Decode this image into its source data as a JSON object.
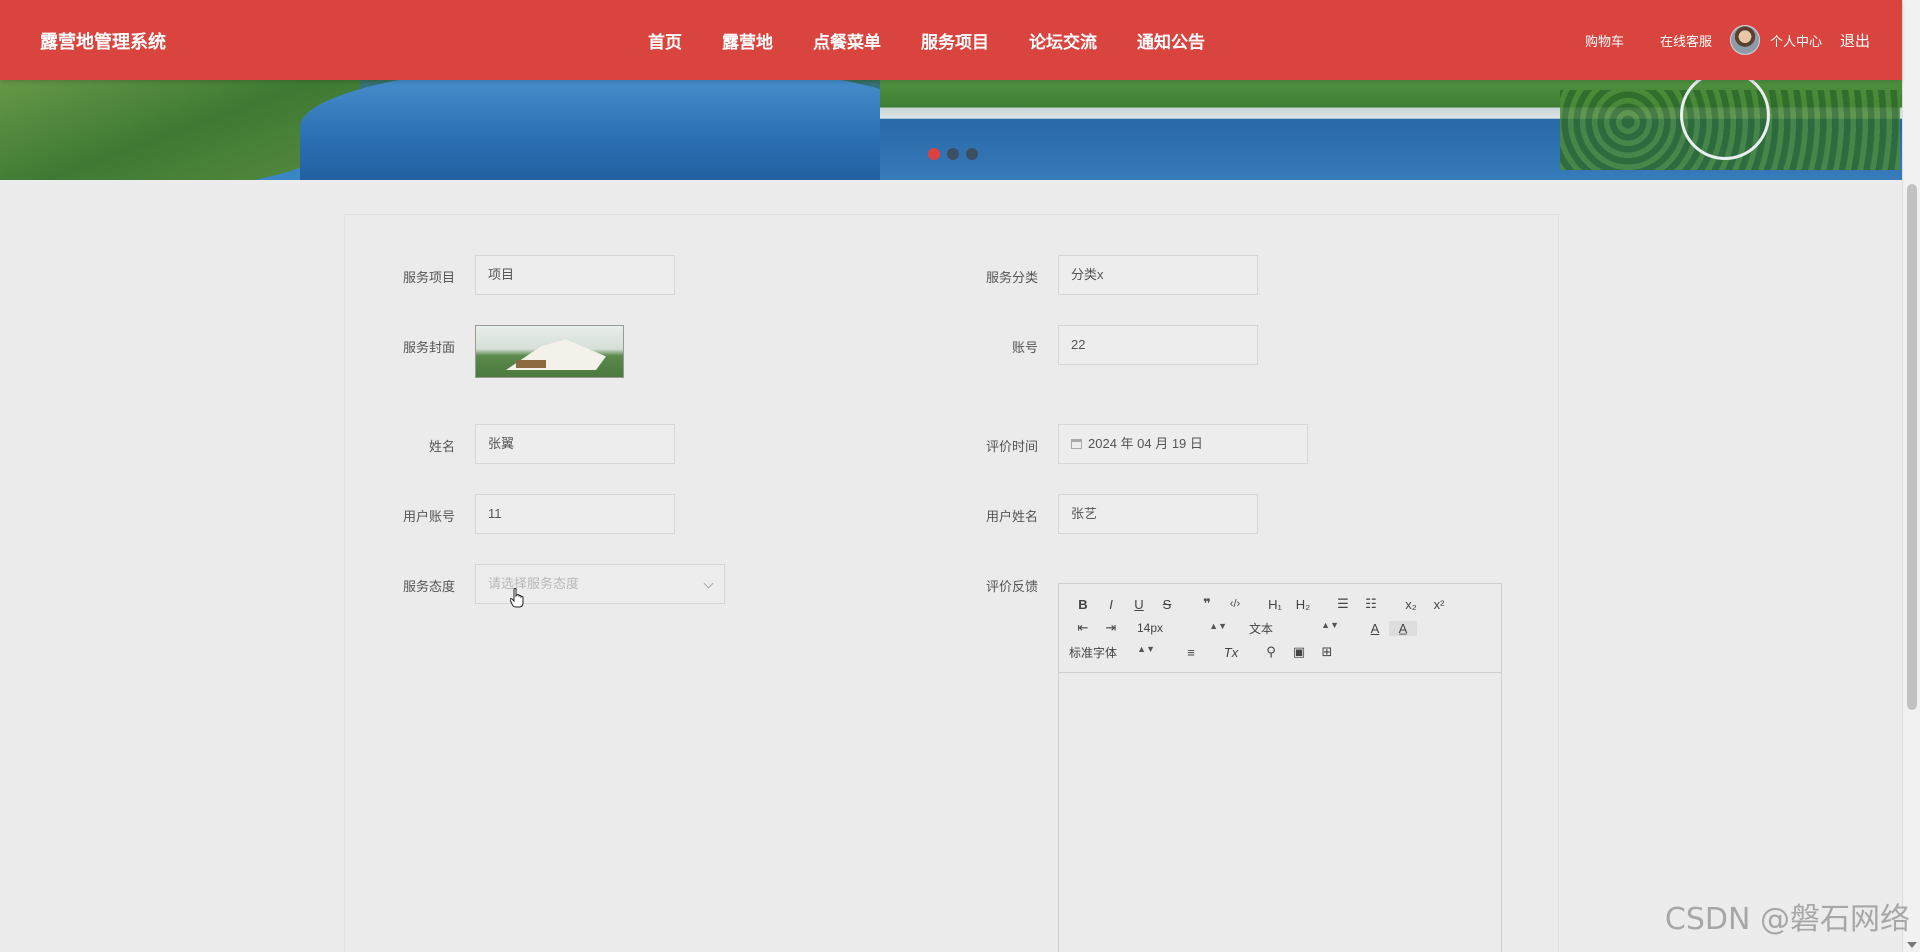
{
  "header": {
    "brand": "露营地管理系统",
    "nav": [
      "首页",
      "露营地",
      "点餐菜单",
      "服务项目",
      "论坛交流",
      "通知公告"
    ],
    "cart": "购物车",
    "service": "在线客服",
    "profile": "个人中心",
    "logout": "退出"
  },
  "banner": {
    "slides": 3,
    "active_slide": 1
  },
  "form": {
    "service_item_label": "服务项目",
    "service_item_value": "项目",
    "service_category_label": "服务分类",
    "service_category_value": "分类x",
    "cover_label": "服务封面",
    "account_label": "账号",
    "account_value": "22",
    "name_label": "姓名",
    "name_value": "张翼",
    "review_time_label": "评价时间",
    "review_time_value": "2024 年 04 月 19 日",
    "user_account_label": "用户账号",
    "user_account_value": "11",
    "user_name_label": "用户姓名",
    "user_name_value": "张艺",
    "attitude_label": "服务态度",
    "attitude_placeholder": "请选择服务态度",
    "feedback_label": "评价反馈"
  },
  "editor": {
    "font_size": "14px",
    "paragraph": "文本",
    "font_family": "标准字体",
    "bold": "B",
    "italic": "I",
    "underline": "U",
    "strike": "S",
    "quote": "❞",
    "code": "‹/›",
    "h1": "H₁",
    "h2": "H₂",
    "ol": "☰",
    "ul": "☷",
    "sub": "x₂",
    "sup": "x²",
    "outdent": "⇤",
    "indent": "⇥",
    "color": "A",
    "bg": "A̲",
    "align": "≡",
    "clean": "Tx",
    "link": "⚲",
    "image": "▣",
    "video": "⊞"
  },
  "watermark": "CSDN @磐石网络",
  "colors": {
    "header": "#d9443f",
    "active_dot": "#e04040"
  }
}
